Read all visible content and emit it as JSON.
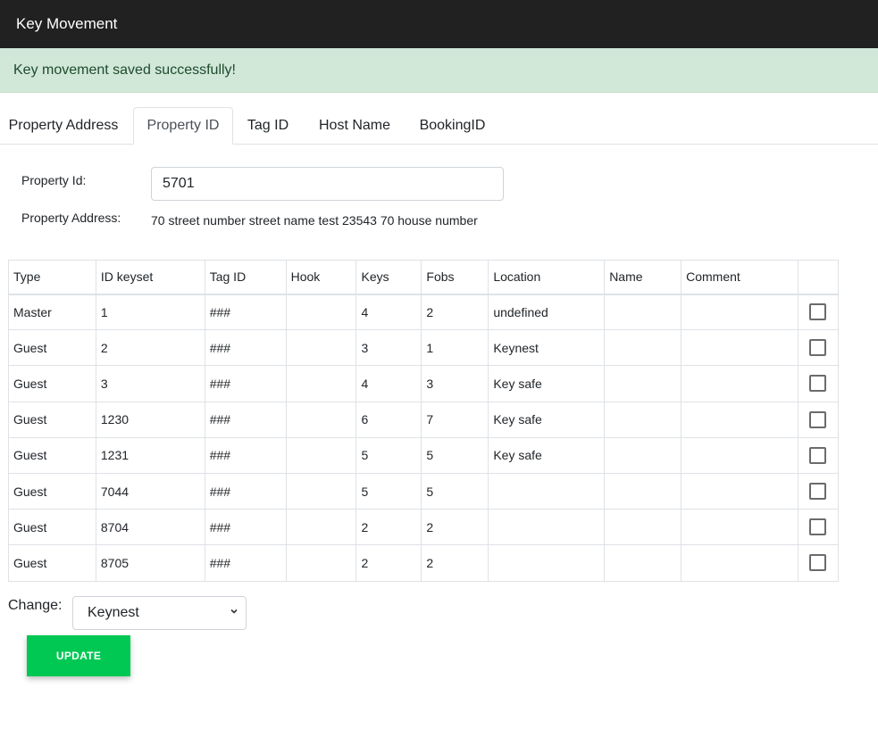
{
  "app": {
    "title": "Key Movement"
  },
  "alert": {
    "message": "Key movement saved successfully!"
  },
  "tabs": [
    {
      "label": "Property Address"
    },
    {
      "label": "Property ID"
    },
    {
      "label": "Tag ID"
    },
    {
      "label": "Host Name"
    },
    {
      "label": "BookingID"
    }
  ],
  "form": {
    "property_id_label": "Property Id:",
    "property_id_value": "5701",
    "property_address_label": "Property Address:",
    "property_address_value": "70 street number street name test 23543 70 house number"
  },
  "table": {
    "headers": [
      "Type",
      "ID keyset",
      "Tag ID",
      "Hook",
      "Keys",
      "Fobs",
      "Location",
      "Name",
      "Comment",
      ""
    ],
    "rows": [
      [
        "Master",
        "1",
        "###",
        "",
        "4",
        "2",
        "undefined",
        "",
        ""
      ],
      [
        "Guest",
        "2",
        "###",
        "",
        "3",
        "1",
        "Keynest",
        "",
        ""
      ],
      [
        "Guest",
        "3",
        "###",
        "",
        "4",
        "3",
        "Key safe",
        "",
        ""
      ],
      [
        "Guest",
        "1230",
        "###",
        "",
        "6",
        "7",
        "Key safe",
        "",
        ""
      ],
      [
        "Guest",
        "1231",
        "###",
        "",
        "5",
        "5",
        "Key safe",
        "",
        ""
      ],
      [
        "Guest",
        "7044",
        "###",
        "",
        "5",
        "5",
        "",
        "",
        ""
      ],
      [
        "Guest",
        "8704",
        "###",
        "",
        "2",
        "2",
        "",
        "",
        ""
      ],
      [
        "Guest",
        "8705",
        "###",
        "",
        "2",
        "2",
        "",
        "",
        ""
      ]
    ]
  },
  "change": {
    "label": "Change:",
    "selected": "Keynest"
  },
  "update_button": {
    "label": "UPDATE"
  },
  "colors": {
    "topbar": "#212121",
    "alert_bg": "#d1e7d8",
    "update_button": "#00c853"
  }
}
